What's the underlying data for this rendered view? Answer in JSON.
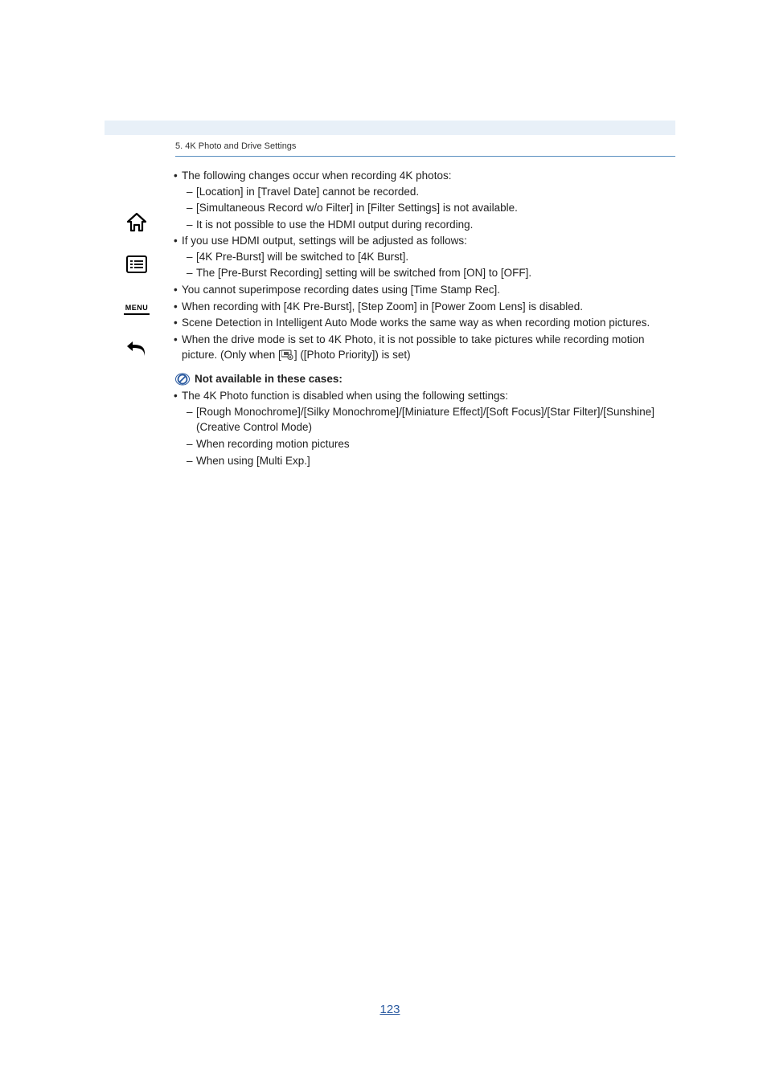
{
  "section_header": "5. 4K Photo and Drive Settings",
  "notes": {
    "b1": {
      "text": "The following changes occur when recording 4K photos:",
      "subs": [
        "[Location] in [Travel Date] cannot be recorded.",
        "[Simultaneous Record w/o Filter] in [Filter Settings] is not available.",
        "It is not possible to use the HDMI output during recording."
      ]
    },
    "b2": {
      "text": "If you use HDMI output, settings will be adjusted as follows:",
      "subs": [
        "[4K Pre-Burst] will be switched to [4K Burst].",
        "The [Pre-Burst Recording] setting will be switched from [ON] to [OFF]."
      ]
    },
    "b3": "You cannot superimpose recording dates using [Time Stamp Rec].",
    "b4": "When recording with [4K Pre-Burst], [Step Zoom] in [Power Zoom Lens] is disabled.",
    "b5": "Scene Detection in Intelligent Auto Mode works the same way as when recording motion pictures.",
    "b6_a": "When the drive mode is set to 4K Photo, it is not possible to take pictures while recording motion picture. (Only when [",
    "b6_b": "] ([Photo Priority]) is set)"
  },
  "na": {
    "title": "Not available in these cases:",
    "b1": {
      "text": "The 4K Photo function is disabled when using the following settings:",
      "subs": [
        "[Rough Monochrome]/[Silky Monochrome]/[Miniature Effect]/[Soft Focus]/[Star Filter]/[Sunshine] (Creative Control Mode)",
        "When recording motion pictures",
        "When using [Multi Exp.]"
      ]
    }
  },
  "page_number": "123",
  "sidebar": {
    "menu": "MENU"
  }
}
